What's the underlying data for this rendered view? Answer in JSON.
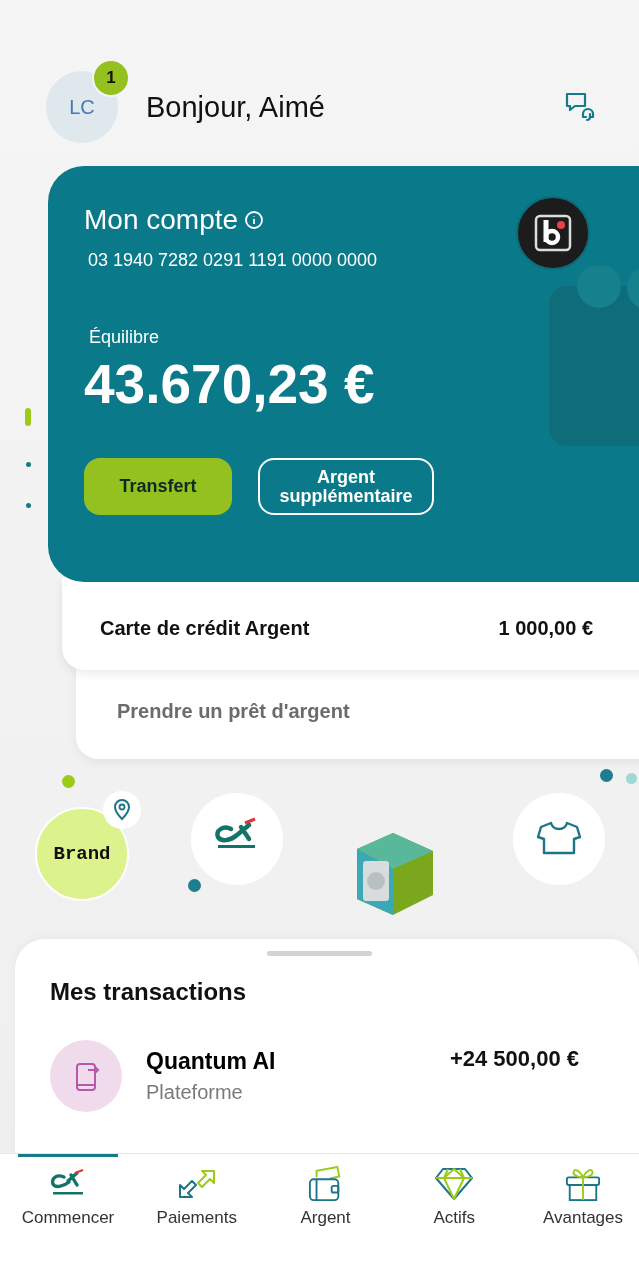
{
  "header": {
    "avatar_initials": "LC",
    "notification_count": "1",
    "greeting": "Bonjour, Aimé"
  },
  "account_card": {
    "title": "Mon compte",
    "account_number": "03 1940 7282 0291 1191 0000 0000",
    "balance_label": "Équilibre",
    "balance": "43.670,23 €",
    "buttons": [
      {
        "label": "Transfert",
        "kind": "primary"
      },
      {
        "label": "Argent supplémentaire",
        "kind": "outline"
      }
    ]
  },
  "credit_card": {
    "label": "Carte de crédit Argent",
    "amount": "1 000,00 €"
  },
  "loan": {
    "label": "Prendre un prêt d'argent"
  },
  "pager": [
    {
      "selected": true
    },
    {
      "selected": false
    },
    {
      "selected": false
    }
  ],
  "shortcuts": [
    {
      "kind": "brand",
      "label": "Brand"
    },
    {
      "kind": "bank"
    },
    {
      "kind": "safe"
    },
    {
      "kind": "shirt"
    }
  ],
  "transactions": {
    "title": "Mes transactions",
    "items": [
      {
        "name": "Quantum AI",
        "category": "Plateforme",
        "amount": "+24 500,00 €"
      }
    ]
  },
  "nav": [
    {
      "label": "Commencer",
      "selected": true
    },
    {
      "label": "Paiements",
      "selected": false
    },
    {
      "label": "Argent",
      "selected": false
    },
    {
      "label": "Actifs",
      "selected": false
    },
    {
      "label": "Avantages",
      "selected": false
    }
  ]
}
